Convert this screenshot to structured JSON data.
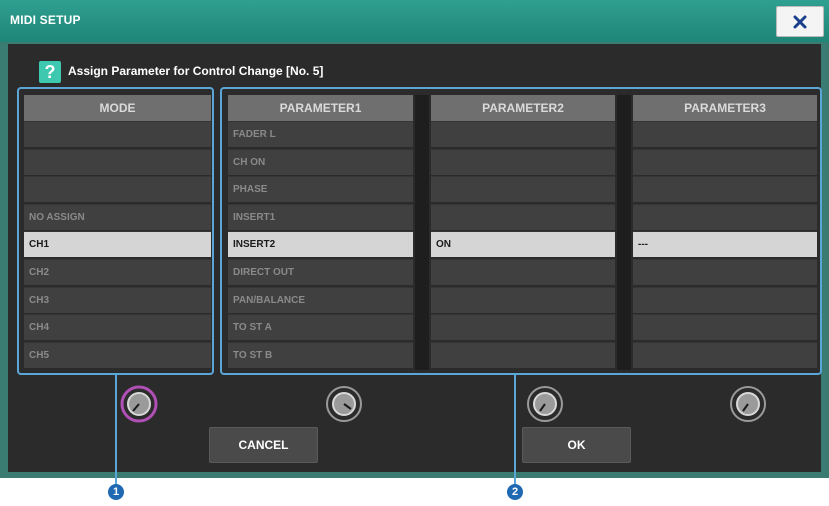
{
  "window": {
    "title": "MIDI SETUP"
  },
  "dialog": {
    "heading": "Assign Parameter for Control Change [No. 5]",
    "help_icon": "?"
  },
  "columns": {
    "mode": {
      "header": "MODE",
      "rows": [
        "",
        "",
        "",
        "NO ASSIGN",
        "CH1",
        "CH2",
        "CH3",
        "CH4",
        "CH5"
      ],
      "selected_index": 4
    },
    "parameter1": {
      "header": "PARAMETER1",
      "rows": [
        "FADER L",
        "CH ON",
        "PHASE",
        "INSERT1",
        "INSERT2",
        "DIRECT OUT",
        "PAN/BALANCE",
        "TO ST A",
        "TO ST B"
      ],
      "selected_index": 4
    },
    "parameter2": {
      "header": "PARAMETER2",
      "rows": [
        "",
        "",
        "",
        "",
        "ON",
        "",
        "",
        "",
        ""
      ],
      "selected_index": 4
    },
    "parameter3": {
      "header": "PARAMETER3",
      "rows": [
        "",
        "",
        "",
        "",
        "---",
        "",
        "",
        "",
        ""
      ],
      "selected_index": 4
    }
  },
  "buttons": {
    "cancel": "CANCEL",
    "ok": "OK"
  },
  "callouts": [
    "1",
    "2"
  ],
  "colors": {
    "titlebar": "#1f8577",
    "highlight": "#5aa6d6",
    "mode_knob_ring": "#b04fb5",
    "callout": "#1f69b2"
  },
  "icons": {
    "close": "close-icon",
    "help": "help-icon",
    "knob": "rotary-knob-icon"
  }
}
